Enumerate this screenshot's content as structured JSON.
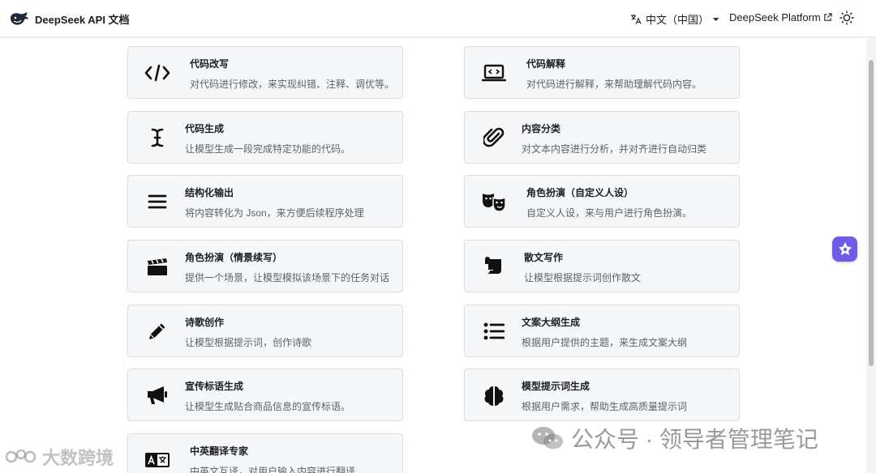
{
  "header": {
    "brand_title": "DeepSeek API 文档",
    "language": "中文（中国）",
    "platform_link": "DeepSeek Platform"
  },
  "cards": [
    {
      "title": "代码改写",
      "description": "对代码进行修改，来实现纠错、注释、调优等。",
      "icon": "code-icon"
    },
    {
      "title": "代码解释",
      "description": "对代码进行解释，来帮助理解代码内容。",
      "icon": "laptop-code-icon"
    },
    {
      "title": "代码生成",
      "description": "让模型生成一段完成特定功能的代码。",
      "icon": "text-cursor-icon"
    },
    {
      "title": "内容分类",
      "description": "对文本内容进行分析，并对齐进行自动归类",
      "icon": "paperclip-icon"
    },
    {
      "title": "结构化输出",
      "description": "将内容转化为 Json，来方便后续程序处理",
      "icon": "bars-icon"
    },
    {
      "title": "角色扮演（自定义人设）",
      "description": "自定义人设，来与用户进行角色扮演。",
      "icon": "masks-icon"
    },
    {
      "title": "角色扮演（情景续写）",
      "description": "提供一个场景，让模型模拟该场景下的任务对话",
      "icon": "clapperboard-icon"
    },
    {
      "title": "散文写作",
      "description": "让模型根据提示词创作散文",
      "icon": "scroll-icon"
    },
    {
      "title": "诗歌创作",
      "description": "让模型根据提示词，创作诗歌",
      "icon": "pencil-icon"
    },
    {
      "title": "文案大纲生成",
      "description": "根据用户提供的主题，来生成文案大纲",
      "icon": "list-icon"
    },
    {
      "title": "宣传标语生成",
      "description": "让模型生成贴合商品信息的宣传标语。",
      "icon": "megaphone-icon"
    },
    {
      "title": "模型提示词生成",
      "description": "根据用户需求，帮助生成高质量提示词",
      "icon": "brain-icon"
    },
    {
      "title": "中英翻译专家",
      "description": "中英文互译，对用户输入内容进行翻译",
      "icon": "language-icon"
    }
  ],
  "watermark": {
    "right": "公众号 · 领导者管理笔记",
    "left": "大数跨境"
  },
  "colors": {
    "card_bg": "#f6f7f8",
    "card_border": "#dadde1",
    "fab_bg": "#6c5ce7"
  }
}
